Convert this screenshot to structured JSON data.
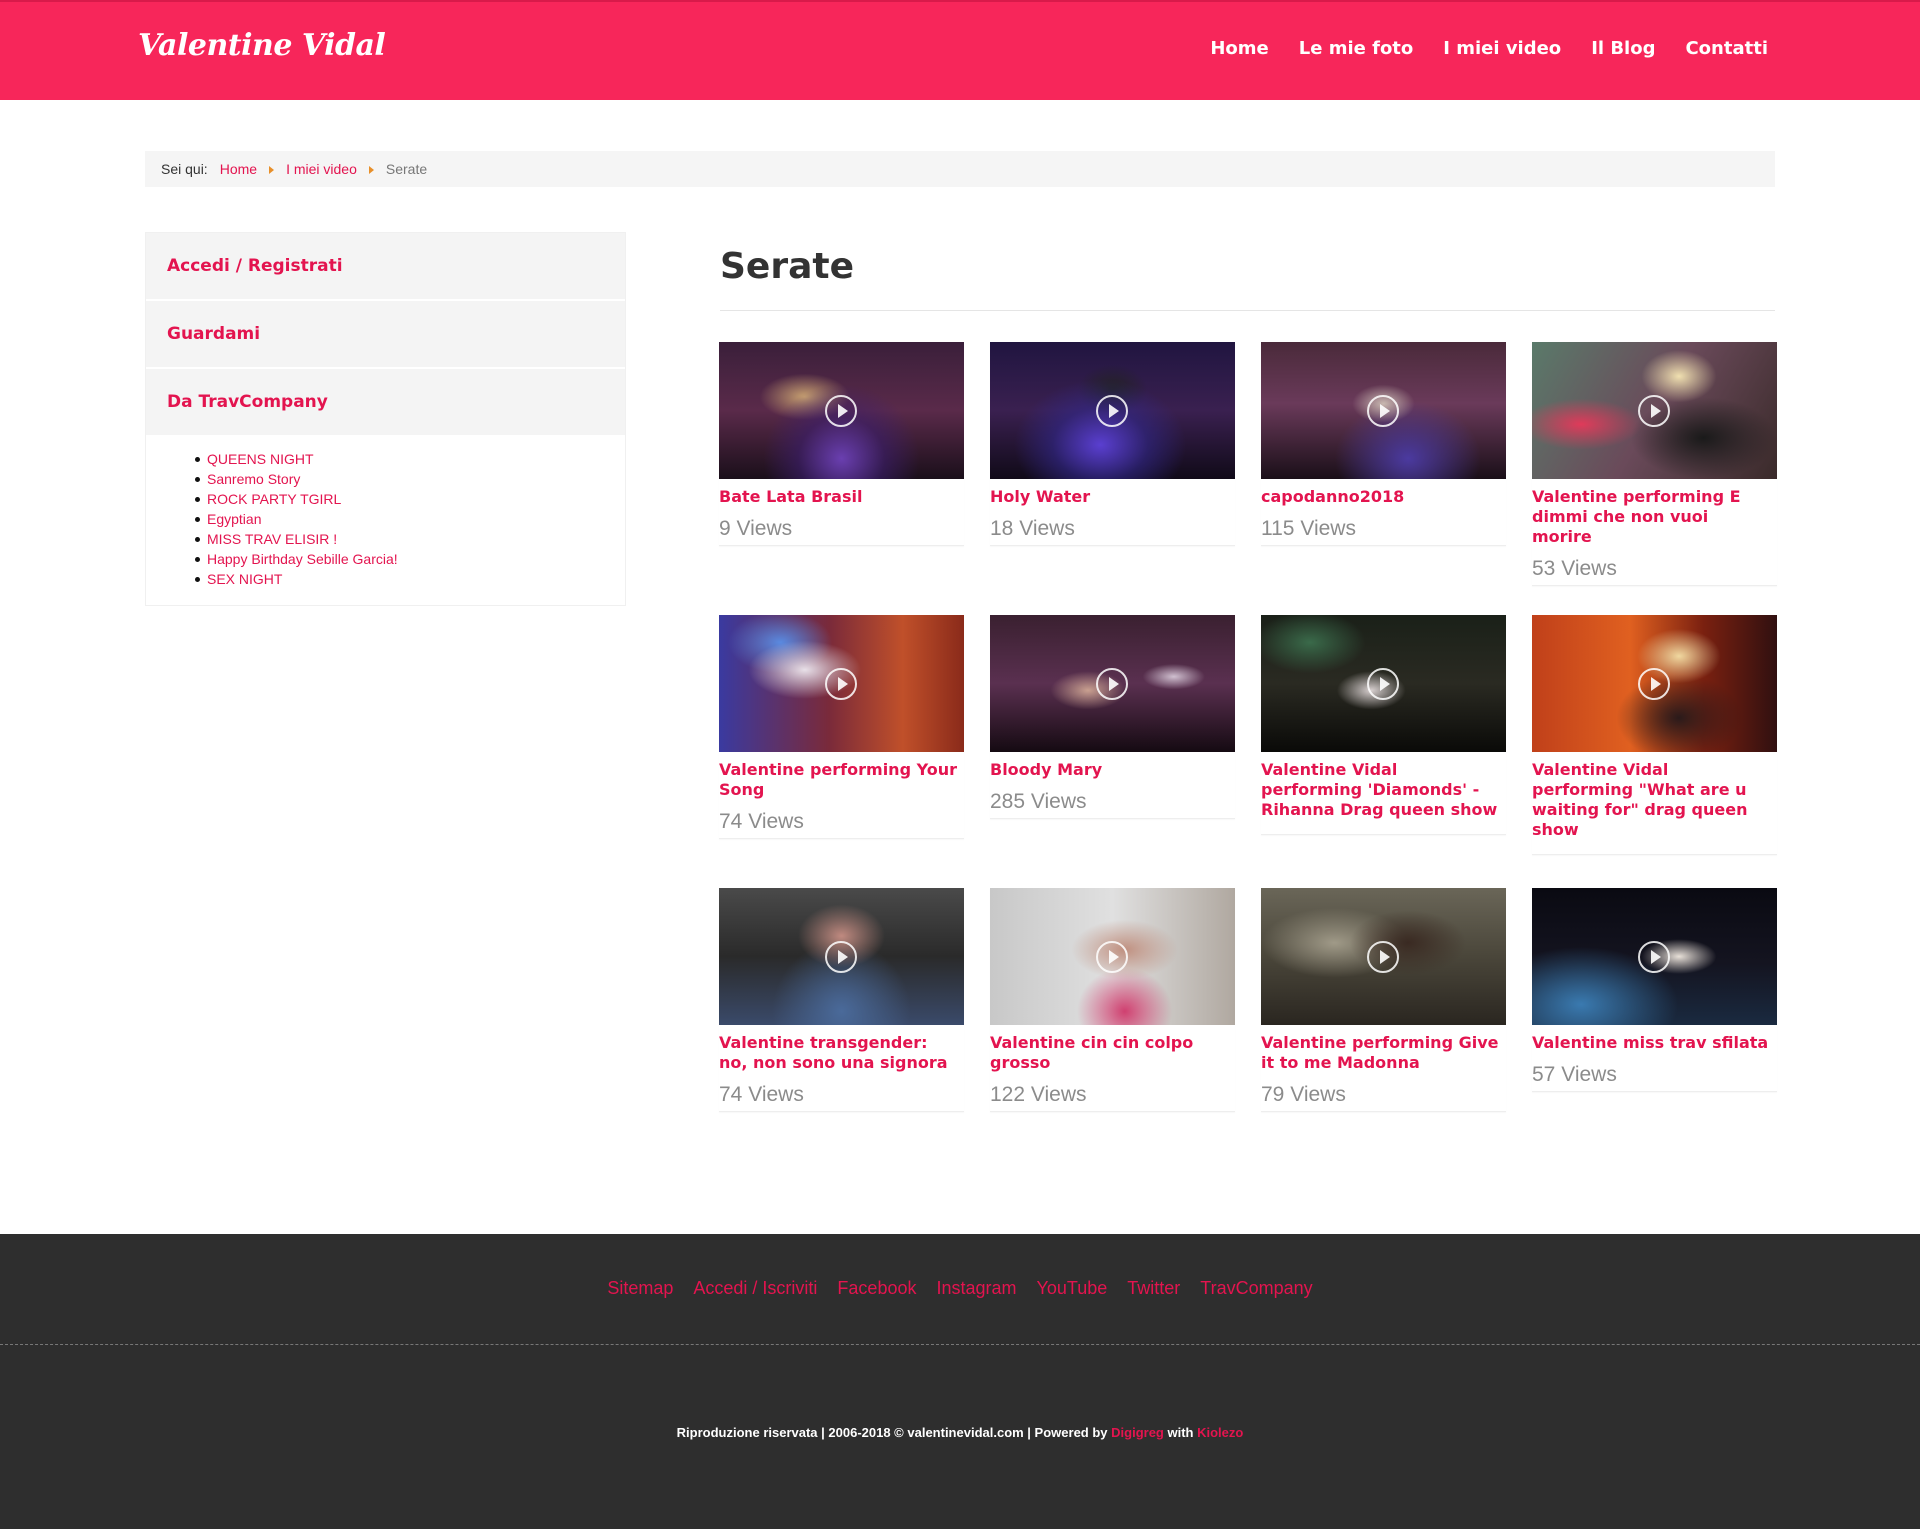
{
  "header": {
    "logo": "Valentine Vidal",
    "nav": [
      "Home",
      "Le mie foto",
      "I miei video",
      "Il Blog",
      "Contatti"
    ]
  },
  "breadcrumb": {
    "label": "Sei qui:",
    "items": [
      "Home",
      "I miei video"
    ],
    "current": "Serate"
  },
  "sidebar": {
    "items": [
      "Accedi / Registrati",
      "Guardami",
      "Da TravCompany"
    ],
    "list": [
      "QUEENS NIGHT",
      "Sanremo Story",
      "ROCK PARTY TGIRL",
      "Egyptian",
      "MISS TRAV ELISIR !",
      "Happy Birthday Sebille Garcia!",
      "SEX NIGHT"
    ]
  },
  "main": {
    "title": "Serate",
    "videos": [
      {
        "title": "Bate Lata Brasil",
        "views": "9 Views"
      },
      {
        "title": "Holy Water",
        "views": "18 Views"
      },
      {
        "title": "capodanno2018",
        "views": "115 Views"
      },
      {
        "title": "Valentine performing E dimmi che non vuoi morire",
        "views": "53 Views"
      },
      {
        "title": "Valentine performing Your Song",
        "views": "74 Views"
      },
      {
        "title": "Bloody Mary",
        "views": "285 Views"
      },
      {
        "title": "Valentine Vidal performing 'Diamonds' - Rihanna Drag queen show",
        "views": ""
      },
      {
        "title": "Valentine Vidal performing \"What are u waiting for\" drag queen show",
        "views": ""
      },
      {
        "title": "Valentine transgender: no, non sono una signora",
        "views": "74 Views"
      },
      {
        "title": "Valentine cin cin colpo grosso",
        "views": "122 Views"
      },
      {
        "title": "Valentine performing Give it to me Madonna",
        "views": "79 Views"
      },
      {
        "title": "Valentine miss trav sfilata",
        "views": "57 Views"
      }
    ]
  },
  "footer": {
    "links": [
      "Sitemap",
      "Accedi / Iscriviti",
      "Facebook",
      "Instagram",
      "YouTube",
      "Twitter",
      "TravCompany"
    ],
    "copyright_text": "Riproduzione riservata | 2006-2018 © valentinevidal.com | Powered by ",
    "powered_by": "Digigreg",
    "with_text": " with ",
    "with_link": "Kiolezo"
  },
  "colors": {
    "brand": "#f7265a",
    "link": "#e3144f",
    "footer_bg": "#2e2e2e"
  }
}
